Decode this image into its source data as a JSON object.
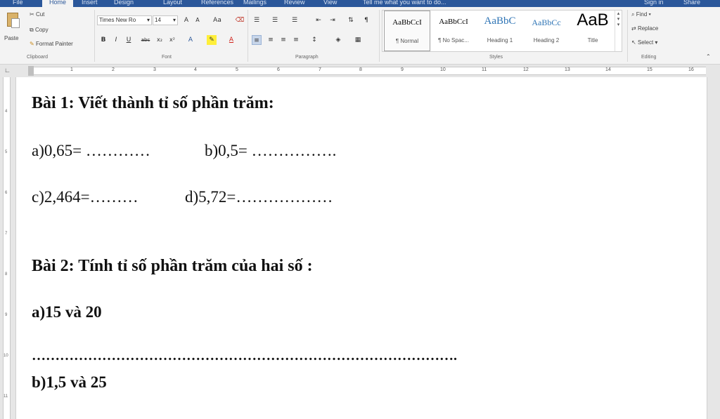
{
  "app": {
    "tabs": [
      "File",
      "Home",
      "Insert",
      "Design",
      "Layout",
      "References",
      "Mailings",
      "Review",
      "View"
    ],
    "tell_me": "Tell me what you want to do...",
    "signin": "Sign in",
    "share": "Share"
  },
  "clipboard": {
    "paste": "Paste",
    "cut": "Cut",
    "copy": "Copy",
    "format_painter": "Format Painter",
    "label": "Clipboard"
  },
  "font": {
    "name": "Times New Ro",
    "size": "14",
    "label": "Font"
  },
  "paragraph": {
    "label": "Paragraph"
  },
  "styles": {
    "label": "Styles",
    "items": [
      {
        "preview": "AaBbCcI",
        "name": "¶ Normal"
      },
      {
        "preview": "AaBbCcI",
        "name": "¶ No Spac..."
      },
      {
        "preview": "AaBbC",
        "name": "Heading 1"
      },
      {
        "preview": "AaBbCc",
        "name": "Heading 2"
      },
      {
        "preview": "AaB",
        "name": "Title"
      }
    ]
  },
  "editing": {
    "find": "Find",
    "replace": "Replace",
    "select": "Select",
    "label": "Editing"
  },
  "ruler": {
    "marks": [
      "1",
      "2",
      "3",
      "4",
      "5",
      "6",
      "7",
      "8",
      "9",
      "10",
      "11",
      "12",
      "13",
      "14",
      "15",
      "16"
    ],
    "vmarks": [
      "4",
      "5",
      "6",
      "7",
      "8",
      "9",
      "10",
      "11"
    ]
  },
  "document": {
    "bai1_title": "Bài 1: Viết thành tỉ số phần trăm:",
    "a": "a)0,65= …………",
    "b": "b)0,5= …………….",
    "c": "c)2,464=………",
    "d": "d)5,72=………………",
    "bai2_title": "Bài 2: Tính tỉ số phần trăm của hai số :",
    "a2": "a)15 và 20",
    "dots": "……………………………………………………………………………….",
    "b2": "b)1,5 và 25"
  }
}
